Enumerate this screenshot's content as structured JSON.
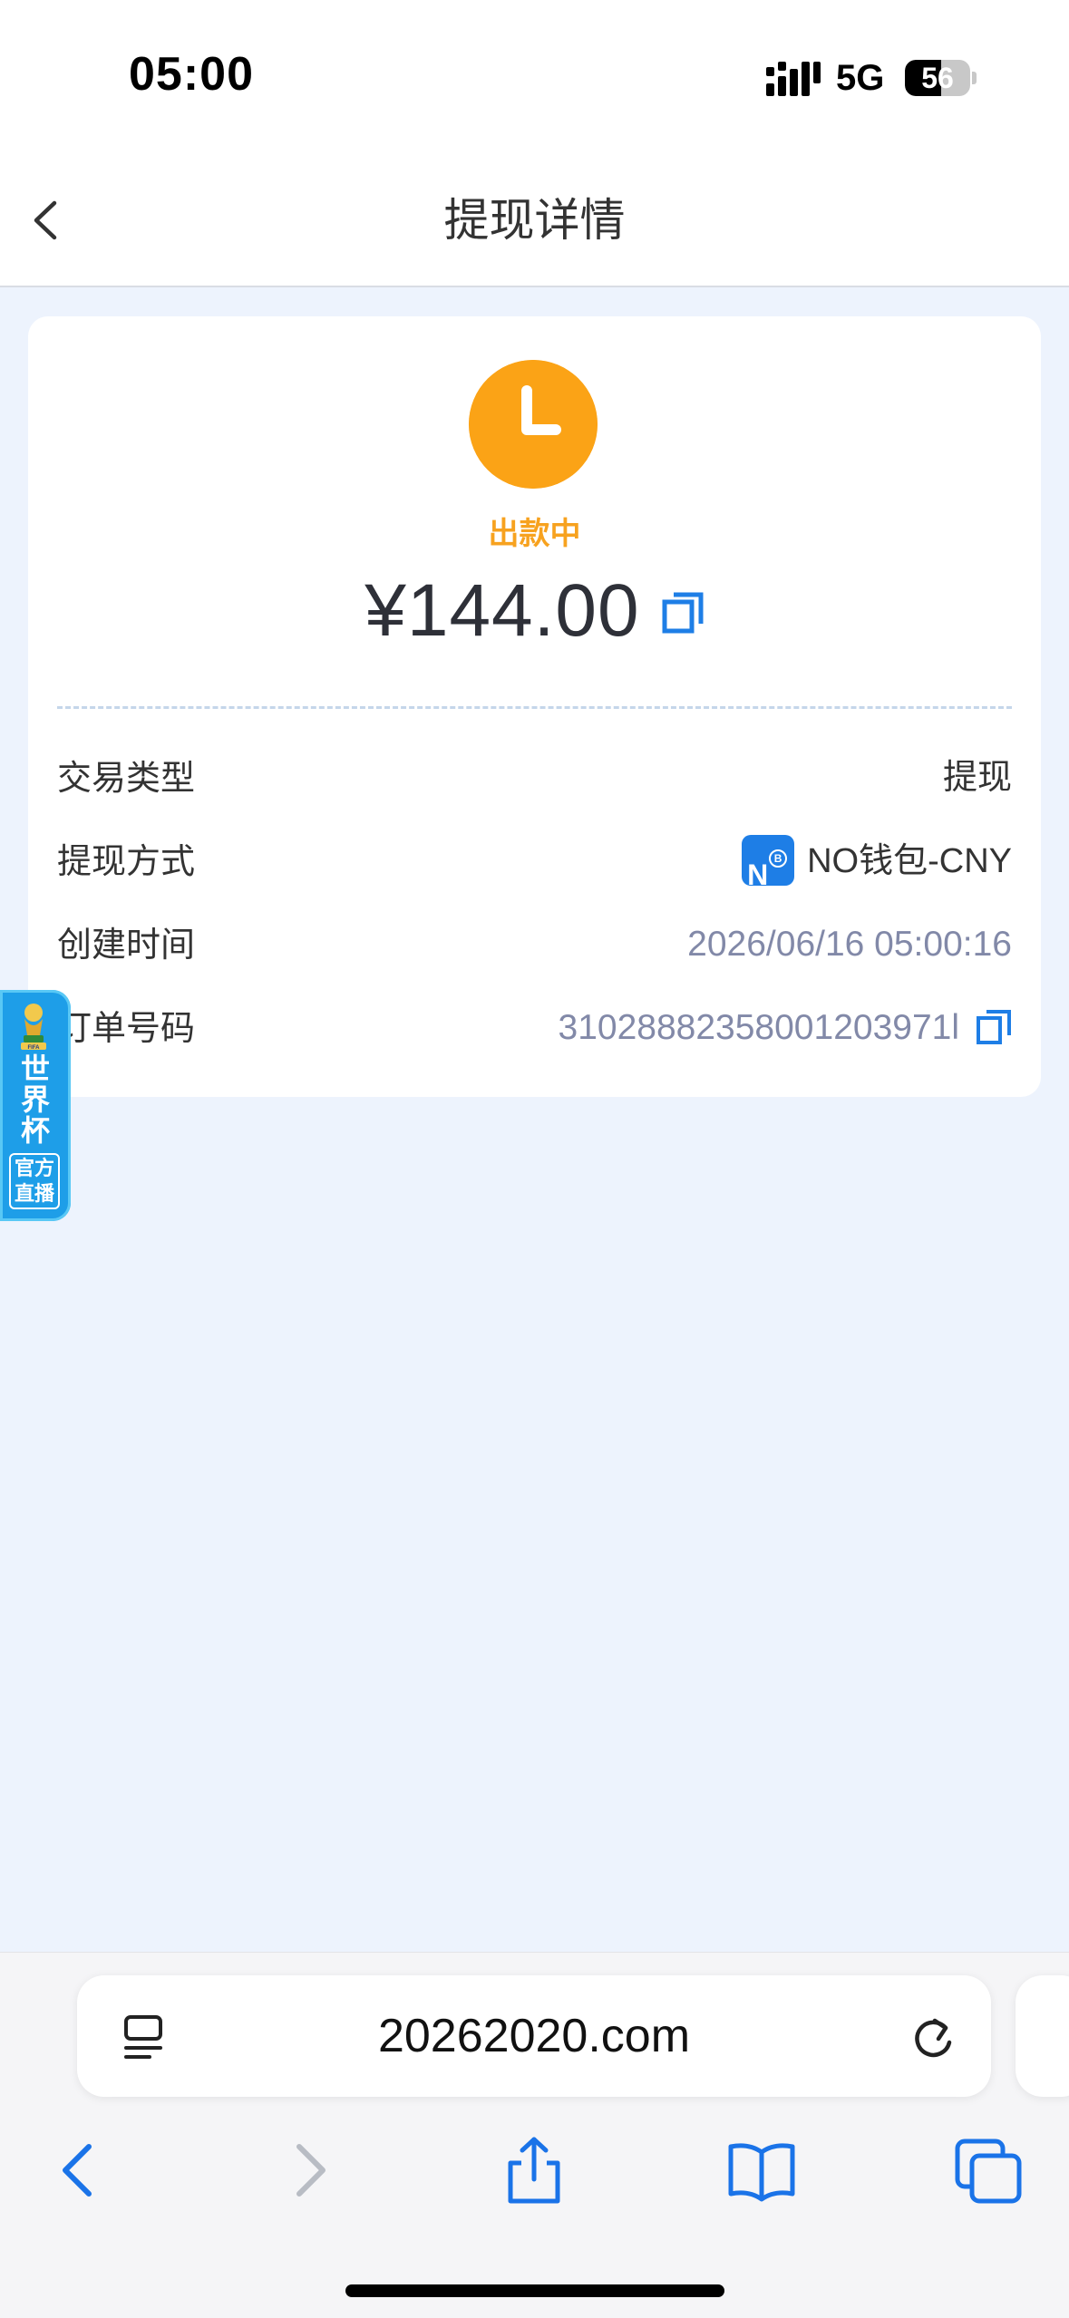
{
  "status_bar": {
    "time": "05:00",
    "network": "5G",
    "battery": "56",
    "battery_level": 0.56
  },
  "nav": {
    "title": "提现详情"
  },
  "detail": {
    "status": "出款中",
    "amount": "¥144.00",
    "rows": [
      {
        "label": "交易类型",
        "value": "提现"
      },
      {
        "label": "提现方式",
        "value": "NO钱包-CNY",
        "badge": "N"
      },
      {
        "label": "创建时间",
        "value": "2026/06/16 05:00:16"
      },
      {
        "label": "订单号码",
        "value": "31028882358001203971l"
      }
    ]
  },
  "promo": {
    "title_line1": "世",
    "title_line2": "界",
    "title_line3": "杯",
    "sub_line1": "官方",
    "sub_line2": "直播",
    "trophy_text": "FIFA"
  },
  "browser": {
    "url": "20262020.com"
  },
  "colors": {
    "accent_orange": "#fba316",
    "accent_blue": "#1e7ee6",
    "page_bg": "#edf3fd",
    "muted_text": "#8289a8"
  }
}
